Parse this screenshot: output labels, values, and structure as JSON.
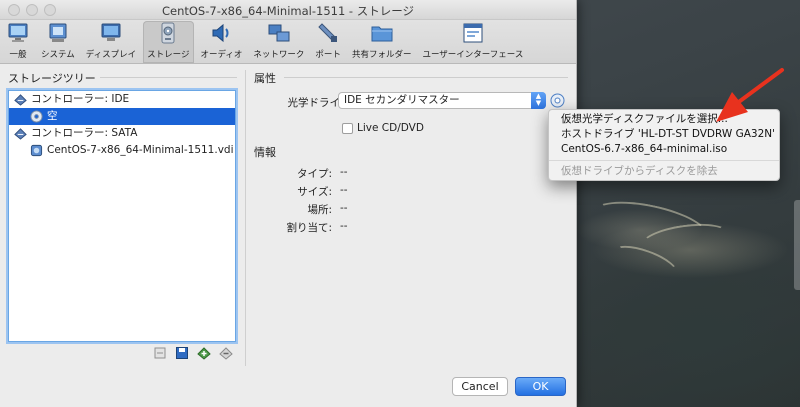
{
  "window": {
    "title": "CentOS-7-x86_64-Minimal-1511 - ストレージ"
  },
  "toolbar": [
    {
      "label": "一般",
      "icon": "monitor-icon",
      "active": false
    },
    {
      "label": "システム",
      "icon": "chip-icon",
      "active": false
    },
    {
      "label": "ディスプレイ",
      "icon": "display-icon",
      "active": false
    },
    {
      "label": "ストレージ",
      "icon": "storage-icon",
      "active": true
    },
    {
      "label": "オーディオ",
      "icon": "speaker-icon",
      "active": false
    },
    {
      "label": "ネットワーク",
      "icon": "network-icon",
      "active": false
    },
    {
      "label": "ポート",
      "icon": "port-icon",
      "active": false
    },
    {
      "label": "共有フォルダー",
      "icon": "folder-icon",
      "active": false
    },
    {
      "label": "ユーザーインターフェース",
      "icon": "ui-icon",
      "active": false
    }
  ],
  "storage_tree": {
    "title": "ストレージツリー",
    "items": [
      {
        "label": "コントローラー: IDE",
        "icon": "ide-controller-icon",
        "level": 0,
        "selected": false
      },
      {
        "label": "空",
        "icon": "optical-disc-icon",
        "level": 1,
        "selected": true
      },
      {
        "label": "コントローラー: SATA",
        "icon": "sata-controller-icon",
        "level": 0,
        "selected": false
      },
      {
        "label": "CentOS-7-x86_64-Minimal-1511.vdi",
        "icon": "hard-disk-icon",
        "level": 1,
        "selected": false
      }
    ]
  },
  "attributes": {
    "title": "属性",
    "optical_drive_label": "光学ドライブ:",
    "optical_drive_value": "IDE セカンダリマスター",
    "live_cd_label": "Live CD/DVD",
    "live_cd_checked": false
  },
  "info": {
    "title": "情報",
    "rows": [
      {
        "key": "タイプ:",
        "value": "--"
      },
      {
        "key": "サイズ:",
        "value": "--"
      },
      {
        "key": "場所:",
        "value": "--"
      },
      {
        "key": "割り当て:",
        "value": "--"
      }
    ]
  },
  "popup_menu": {
    "items": [
      {
        "label": "仮想光学ディスクファイルを選択...",
        "enabled": true
      },
      {
        "label": "ホストドライブ 'HL-DT-ST DVDRW  GA32N'",
        "enabled": true
      },
      {
        "label": "CentOS-6.7-x86_64-minimal.iso",
        "enabled": true
      },
      {
        "label": "仮想ドライブからディスクを除去",
        "enabled": false
      }
    ]
  },
  "buttons": {
    "cancel": "Cancel",
    "ok": "OK"
  },
  "colors": {
    "accent": "#1a63d6",
    "annotation_arrow": "#e8321e"
  }
}
